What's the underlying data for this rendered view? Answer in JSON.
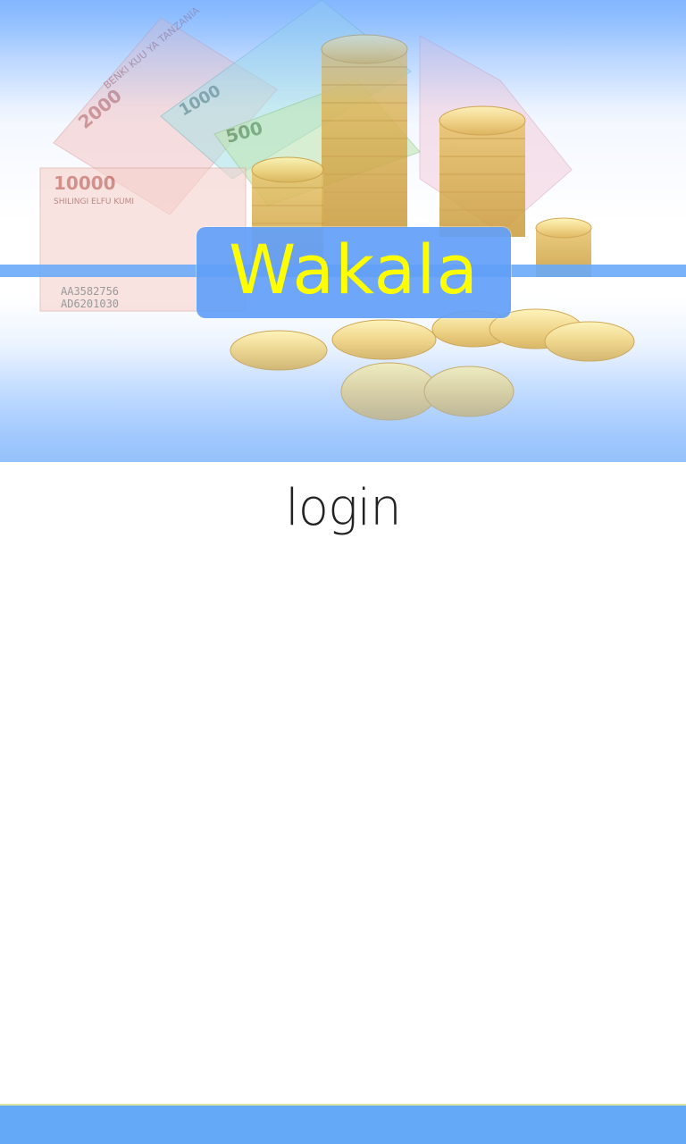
{
  "app": {
    "logo_text": "Wakala"
  },
  "hero": {
    "image": "banknotes-and-gold-coins-illustration",
    "banknote_labels": [
      "10000",
      "SHILINGI ELFU KUMI",
      "2000",
      "1000",
      "500",
      "BENKI KUU YA TANZANIA",
      "AA3582756",
      "AD6201030"
    ]
  },
  "login": {
    "title": "login"
  },
  "colors": {
    "accent": "#64a8f8",
    "logo_text": "#ffff00",
    "logo_bg": "#62a0f8",
    "title_text": "#222222"
  }
}
